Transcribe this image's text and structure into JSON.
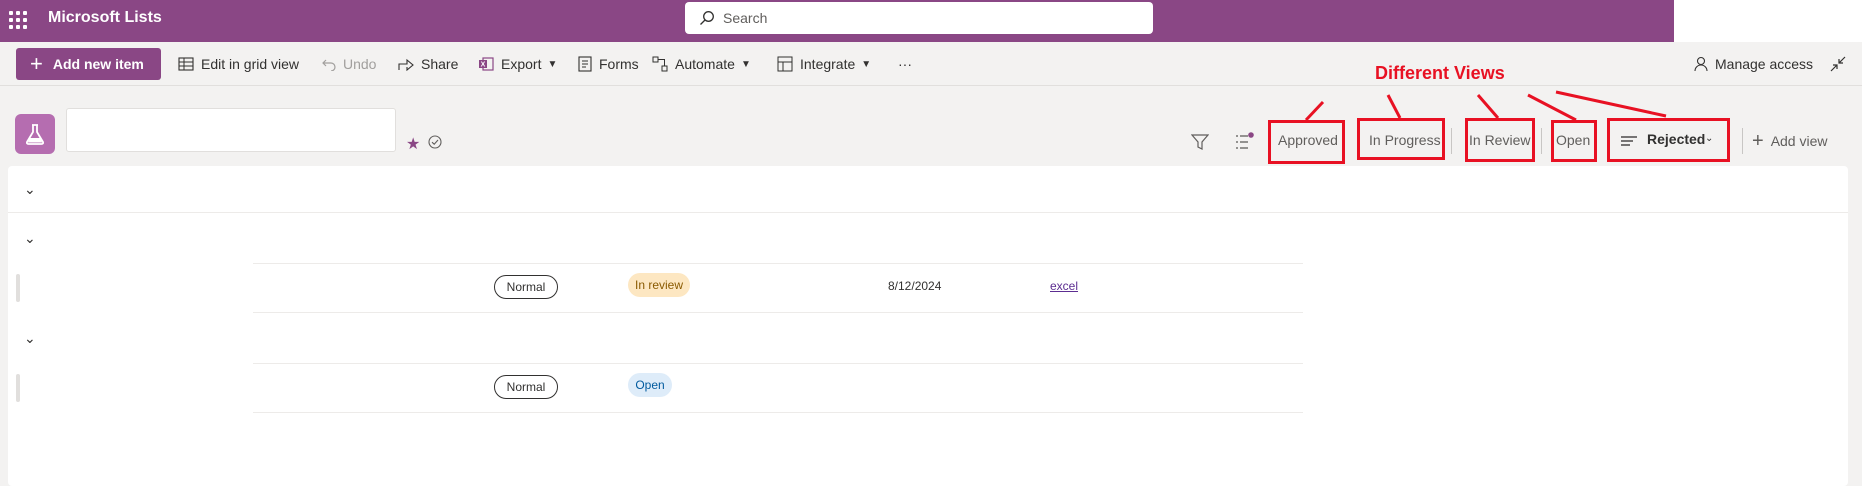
{
  "app": {
    "title": "Microsoft Lists"
  },
  "search": {
    "placeholder": "Search"
  },
  "toolbar": {
    "add_new_item": "Add new item",
    "edit_grid_view": "Edit in grid view",
    "undo": "Undo",
    "share": "Share",
    "export": "Export",
    "forms": "Forms",
    "automate": "Automate",
    "integrate": "Integrate",
    "more": "···",
    "manage_access": "Manage access"
  },
  "views": {
    "items": [
      "Approved",
      "In Progress",
      "In Review",
      "Open",
      "Rejected"
    ],
    "active": "Rejected",
    "add_view": "Add view"
  },
  "annotation": {
    "label": "Different Views",
    "color": "#e81123"
  },
  "rows": [
    {
      "priority": "Normal",
      "status": "In review",
      "status_bg": "#fde7c2",
      "status_fg": "#8a5a00",
      "date": "8/12/2024",
      "link": "excel"
    },
    {
      "priority": "Normal",
      "status": "Open",
      "status_bg": "#deecf9",
      "status_fg": "#005a9e",
      "date": "",
      "link": ""
    }
  ],
  "colors": {
    "brand": "#8a4785",
    "accent_icon": "#b56db0"
  }
}
